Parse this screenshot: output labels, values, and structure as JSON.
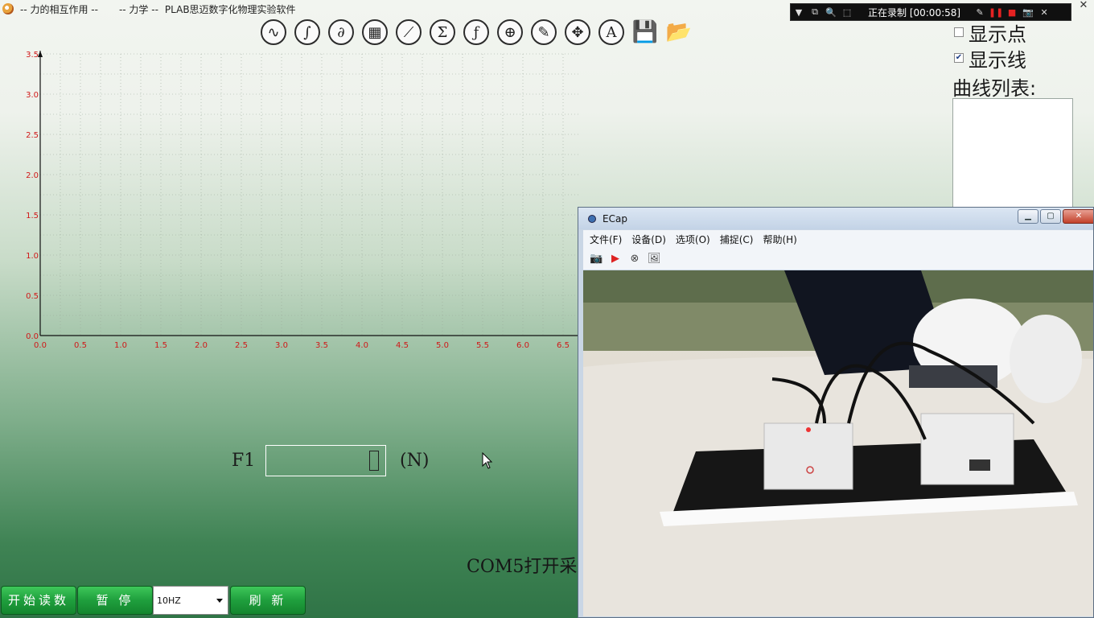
{
  "app": {
    "title_part1": "-- 力的相互作用 --",
    "title_part2": "-- 力学 --",
    "title_part3": "PLAB思迈数字化物理实验软件",
    "close_glyph": "✕"
  },
  "recorder": {
    "status": "正在录制 [00:00:58]"
  },
  "toolbar": {
    "tools": [
      {
        "name": "sine-wave-tool",
        "glyph": "∿"
      },
      {
        "name": "integral-tool",
        "glyph": "∫"
      },
      {
        "name": "derivative-tool",
        "glyph": "∂"
      },
      {
        "name": "chip-tool",
        "glyph": "▦"
      },
      {
        "name": "fit-line-tool",
        "glyph": "⟋"
      },
      {
        "name": "sum-tool",
        "glyph": "Σ"
      },
      {
        "name": "function-tool",
        "glyph": "ƒ"
      },
      {
        "name": "crosshair-tool",
        "glyph": "⊕"
      },
      {
        "name": "pen-tool",
        "glyph": "✎"
      },
      {
        "name": "move-tool",
        "glyph": "✥"
      },
      {
        "name": "text-tool",
        "glyph": "A"
      }
    ],
    "save_glyph": "💾",
    "open_glyph": "📂"
  },
  "right_panel": {
    "show_points_label": "显示点",
    "show_points_checked": false,
    "show_lines_label": "显示线",
    "show_lines_checked": true,
    "curve_list_label": "曲线列表:"
  },
  "readout": {
    "channel_label": "F1",
    "value": "",
    "unit": "(N)"
  },
  "status_text": "COM5打开采",
  "controls": {
    "start_label": "开始读数",
    "pause_label": "暂 停",
    "frequency_value": "10HZ",
    "refresh_label": "刷 新"
  },
  "ecap": {
    "title": "ECap",
    "menus": [
      "文件(F)",
      "设备(D)",
      "选项(O)",
      "捕捉(C)",
      "帮助(H)"
    ]
  },
  "chart_data": {
    "type": "line",
    "x_ticks": [
      "0.0",
      "0.5",
      "1.0",
      "1.5",
      "2.0",
      "2.5",
      "3.0",
      "3.5",
      "4.0",
      "4.5",
      "5.0",
      "5.5",
      "6.0",
      "6.5"
    ],
    "y_ticks": [
      "0.0",
      "0.5",
      "1.0",
      "1.5",
      "2.0",
      "2.5",
      "3.0",
      "3.5"
    ],
    "xlim": [
      0,
      6.5
    ],
    "ylim": [
      0,
      3.5
    ],
    "grid": true,
    "series": []
  }
}
